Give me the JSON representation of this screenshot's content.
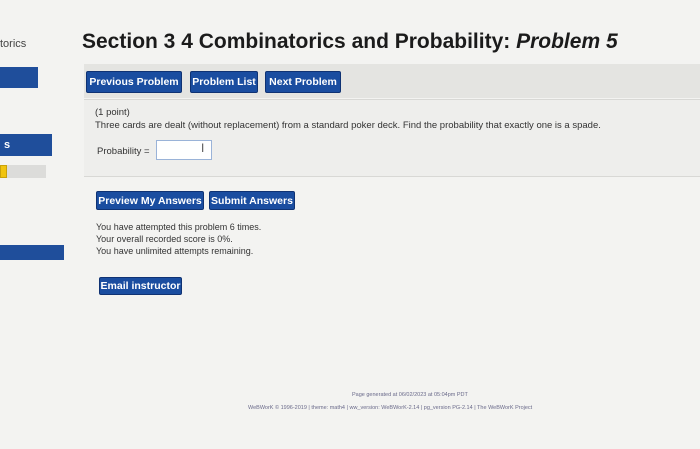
{
  "sidebar": {
    "brand_fragment": "torics",
    "selected_item_label": "s"
  },
  "header": {
    "title_main": "Section 3 4 Combinatorics and Probability: ",
    "title_problem": "Problem 5"
  },
  "nav": {
    "previous_label": "Previous Problem",
    "list_label": "Problem List",
    "next_label": "Next Problem"
  },
  "problem": {
    "points": "(1 point)",
    "question": "Three cards are dealt (without replacement) from a standard poker deck. Find the probability that exactly one is a spade.",
    "answer_label": "Probability =",
    "answer_value": "",
    "cursor_glyph": "I"
  },
  "actions": {
    "preview_label": "Preview My Answers",
    "submit_label": "Submit Answers"
  },
  "status": {
    "attempts": "You have attempted this problem 6 times.",
    "score": "Your overall recorded score is 0%.",
    "remaining": "You have unlimited attempts remaining."
  },
  "email_label": "Email instructor",
  "footer": {
    "generated": "Page generated at 06/02/2023 at 05:04pm PDT",
    "credits": "WeBWorK © 1996-2019 | theme: math4 | ww_version: WeBWorK-2.14 | pg_version PG-2.14 | The WeBWorK Project"
  },
  "colors": {
    "accent": "#1a4da0",
    "background": "#f3f3f1",
    "check_indicator": "#f1c40f"
  }
}
